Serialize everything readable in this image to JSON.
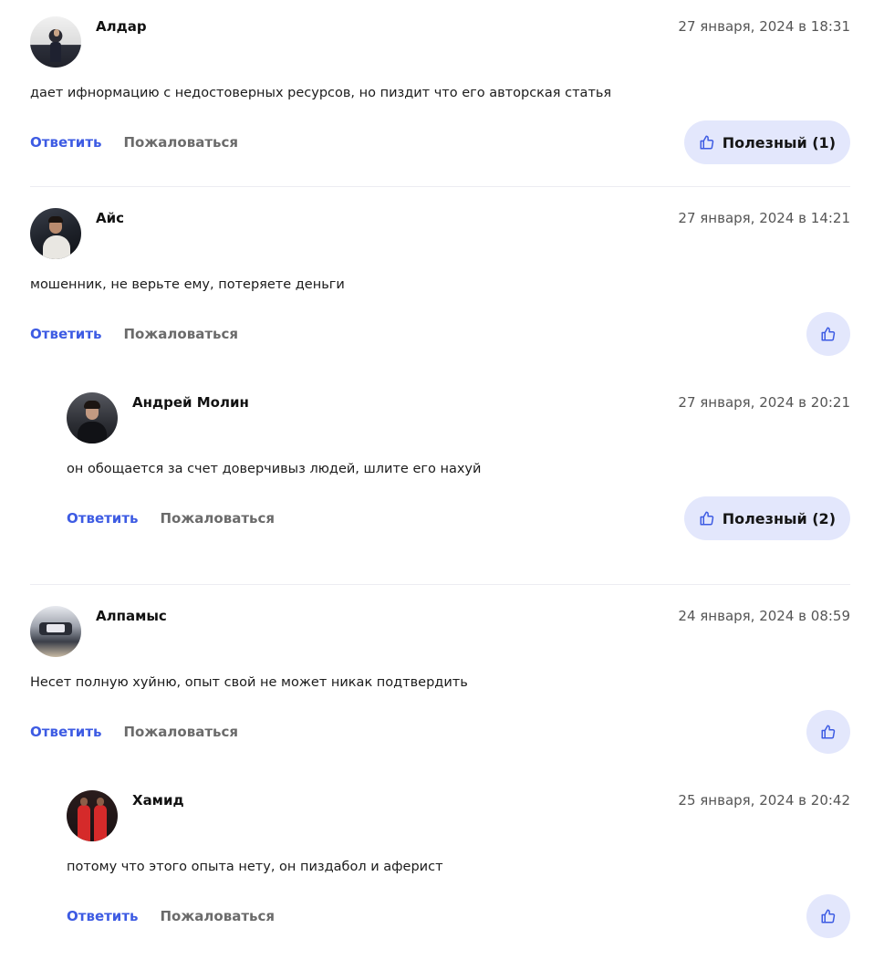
{
  "colors": {
    "accent": "#3d5be3",
    "useful_bg": "#e3e7fc",
    "muted": "#6b6b6b",
    "divider": "#ececf2"
  },
  "labels": {
    "reply": "Ответить",
    "complain": "Пожаловаться"
  },
  "comments": [
    {
      "author": "Алдар",
      "date": "27 января, 2024 в 18:31",
      "text": "дает ифнормацию с недостоверных ресурсов, но пиздит что его авторская статья",
      "useful_label": "Полезный (1)",
      "avatar_icon": "avatar-photo-man-suit"
    },
    {
      "author": "Айс",
      "date": "27 января, 2024 в 14:21",
      "text": "мошенник, не верьте ему, потеряете деньги",
      "useful_label": "",
      "avatar_icon": "avatar-photo-man-white",
      "replies": [
        {
          "author": "Андрей Молин",
          "date": "27 января, 2024 в 20:21",
          "text": "он обощается за счет доверчивыз людей, шлите его нахуй",
          "useful_label": "Полезный (2)",
          "avatar_icon": "avatar-photo-man-dark"
        }
      ]
    },
    {
      "author": "Алпамыс",
      "date": "24 января, 2024 в 08:59",
      "text": "Несет полную хуйню, опыт свой не может никак подтвердить",
      "useful_label": "",
      "avatar_icon": "avatar-photo-car-m5",
      "replies": [
        {
          "author": "Хамид",
          "date": "25 января, 2024 в 20:42",
          "text": "потому что этого опыта нету, он пиздабол и аферист",
          "useful_label": "",
          "avatar_icon": "avatar-photo-people-red"
        }
      ]
    }
  ]
}
